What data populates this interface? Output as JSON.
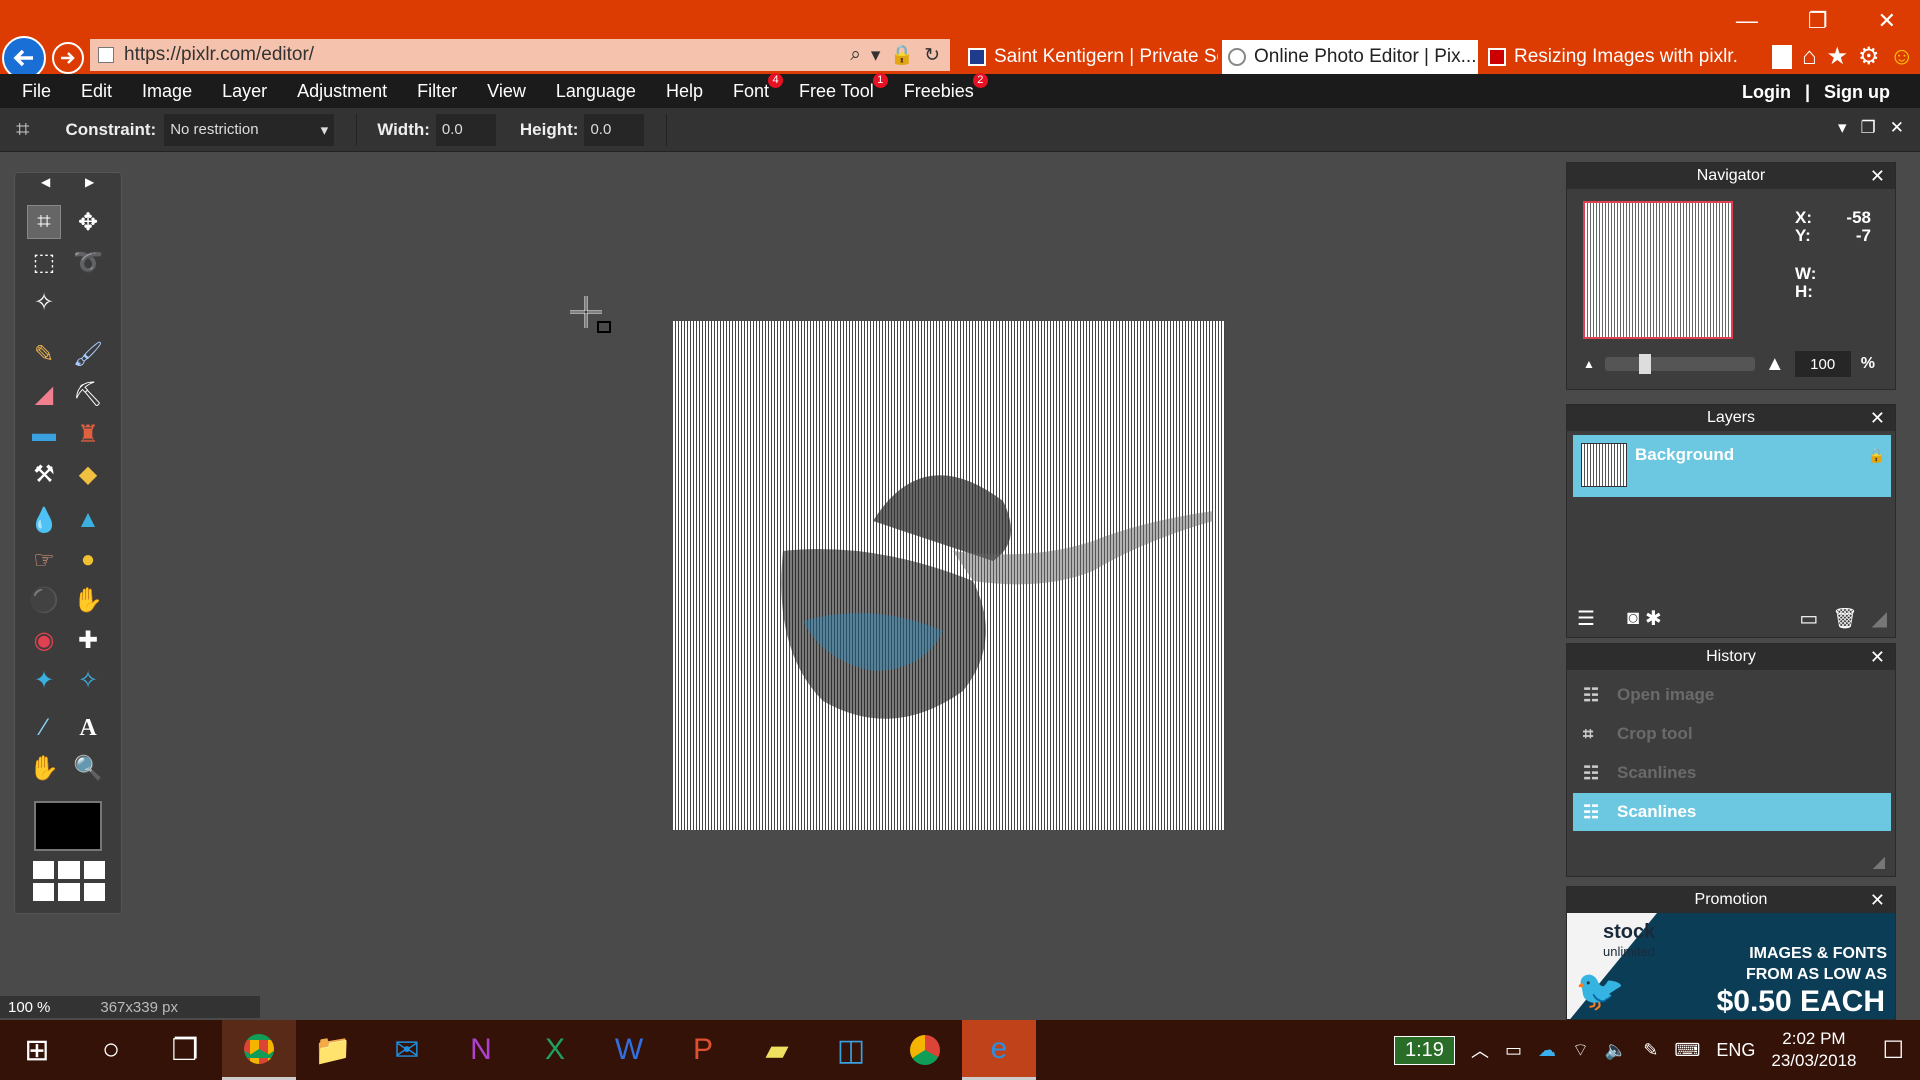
{
  "browser": {
    "url": "https://pixlr.com/editor/",
    "tabs": [
      {
        "title": "Saint Kentigern | Private Sc...",
        "active": false
      },
      {
        "title": "Online Photo Editor | Pix...",
        "active": true,
        "close": "✕"
      },
      {
        "title": "Resizing Images with pixlr....",
        "active": false
      }
    ],
    "accent": "#dc3b02"
  },
  "menu": {
    "items": [
      {
        "label": "File"
      },
      {
        "label": "Edit"
      },
      {
        "label": "Image"
      },
      {
        "label": "Layer"
      },
      {
        "label": "Adjustment"
      },
      {
        "label": "Filter"
      },
      {
        "label": "View"
      },
      {
        "label": "Language"
      },
      {
        "label": "Help"
      },
      {
        "label": "Font",
        "badge": "4"
      },
      {
        "label": "Free Tool",
        "badge": "1"
      },
      {
        "label": "Freebies",
        "badge": "2"
      }
    ],
    "login": "Login",
    "separator": "|",
    "signup": "Sign up"
  },
  "options": {
    "constraint_label": "Constraint:",
    "constraint_value": "No restriction",
    "width_label": "Width:",
    "width_value": "0.0",
    "height_label": "Height:",
    "height_value": "0.0"
  },
  "navigator": {
    "title": "Navigator",
    "x_label": "X:",
    "x_value": "-58",
    "y_label": "Y:",
    "y_value": "-7",
    "w_label": "W:",
    "w_value": "",
    "h_label": "H:",
    "h_value": "",
    "zoom": "100",
    "zoom_unit": "%",
    "zoom_fraction": 0.25
  },
  "layers": {
    "title": "Layers",
    "items": [
      {
        "name": "Background",
        "locked": true
      }
    ]
  },
  "history": {
    "title": "History",
    "items": [
      {
        "label": "Open image",
        "active": false
      },
      {
        "label": "Crop tool",
        "active": false
      },
      {
        "label": "Scanlines",
        "active": false
      },
      {
        "label": "Scanlines",
        "active": true
      }
    ]
  },
  "promotion": {
    "title": "Promotion",
    "logo": "stock",
    "logo_sub": "unlimited",
    "line1": "IMAGES & FONTS",
    "line2": "FROM AS LOW AS",
    "price": "$0.50 EACH"
  },
  "status": {
    "zoom": "100",
    "zoom_unit": "%",
    "dimensions": "367x339 px"
  },
  "taskbar": {
    "battery_time": "1:19",
    "language": "ENG",
    "time": "2:02 PM",
    "date": "23/03/2018"
  }
}
